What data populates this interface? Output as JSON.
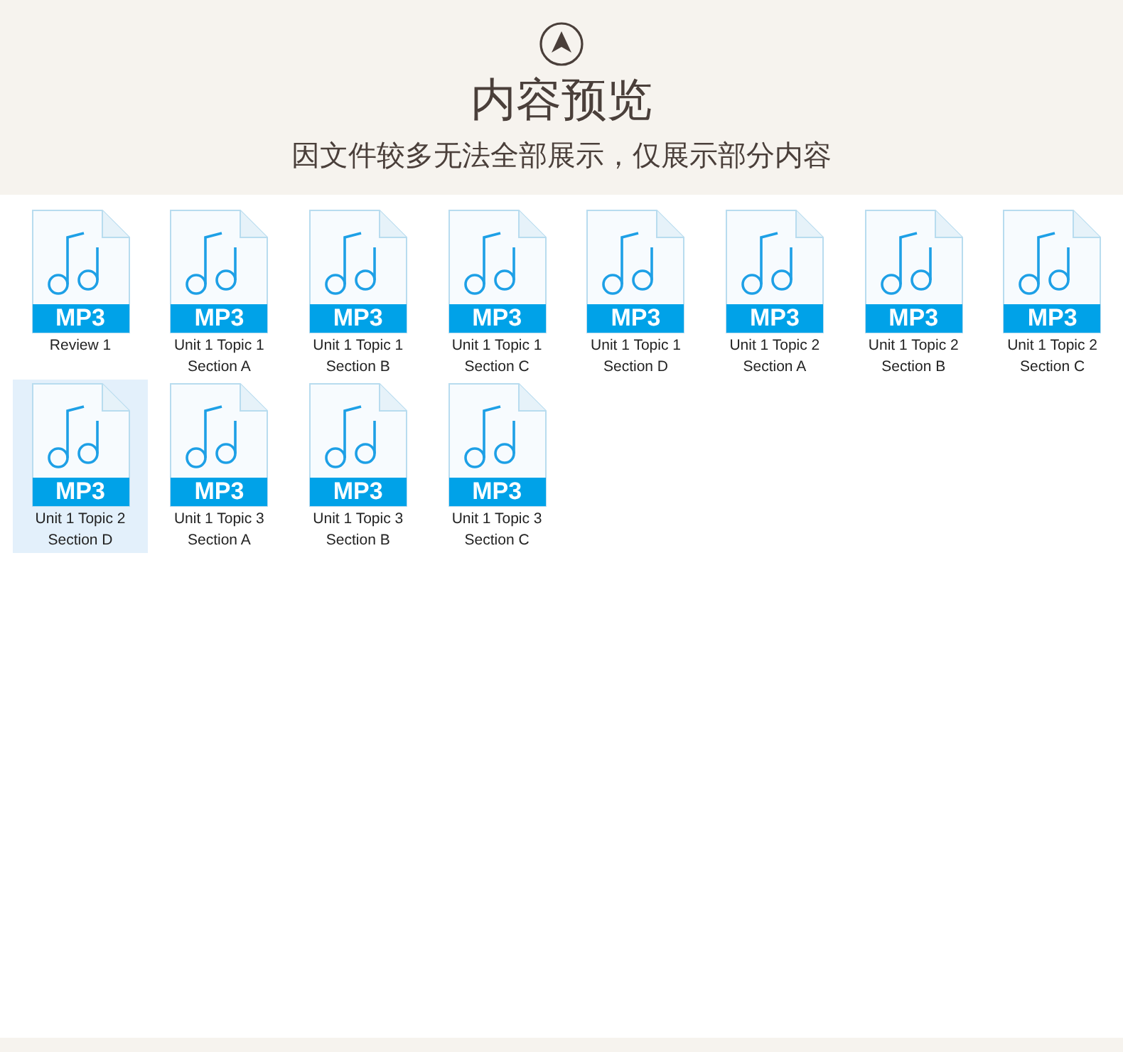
{
  "header": {
    "title": "内容预览",
    "subtitle": "因文件较多无法全部展示，仅展示部分内容"
  },
  "files": [
    {
      "type": "MP3",
      "name": "Review 1",
      "selected": false
    },
    {
      "type": "MP3",
      "name": "Unit 1 Topic 1 Section A",
      "selected": false
    },
    {
      "type": "MP3",
      "name": "Unit 1 Topic 1 Section B",
      "selected": false
    },
    {
      "type": "MP3",
      "name": "Unit 1 Topic 1 Section C",
      "selected": false
    },
    {
      "type": "MP3",
      "name": "Unit 1 Topic 1 Section D",
      "selected": false
    },
    {
      "type": "MP3",
      "name": "Unit 1 Topic 2 Section A",
      "selected": false
    },
    {
      "type": "MP3",
      "name": "Unit 1 Topic 2 Section B",
      "selected": false
    },
    {
      "type": "MP3",
      "name": "Unit 1 Topic 2 Section C",
      "selected": false
    },
    {
      "type": "MP3",
      "name": "Unit 1 Topic 2 Section D",
      "selected": true
    },
    {
      "type": "MP3",
      "name": "Unit 1 Topic 3 Section A",
      "selected": false
    },
    {
      "type": "MP3",
      "name": "Unit 1 Topic 3 Section B",
      "selected": false
    },
    {
      "type": "MP3",
      "name": "Unit 1 Topic 3 Section C",
      "selected": false
    }
  ]
}
